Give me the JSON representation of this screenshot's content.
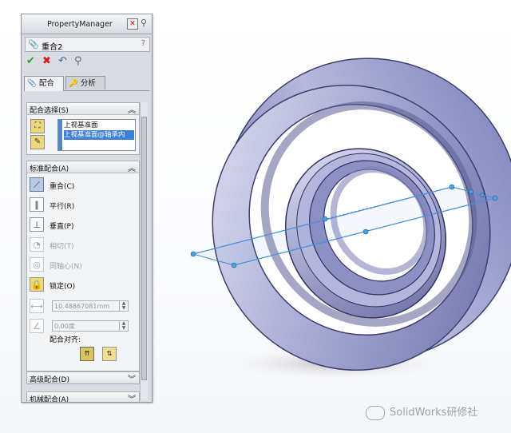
{
  "panel": {
    "title": "PropertyManager",
    "feature_name": "重合2",
    "help": "?",
    "tabs": [
      {
        "label": "配合"
      },
      {
        "label": "分析"
      }
    ],
    "sections": {
      "selections": {
        "title": "配合选择(S)",
        "items": [
          "上视基准面",
          "上视基准面@轴承内"
        ]
      },
      "standard": {
        "title": "标准配合(A)",
        "mates": [
          {
            "label": "重合(C)",
            "icon": "coincident-icon",
            "active": true,
            "enabled": true
          },
          {
            "label": "平行(R)",
            "icon": "parallel-icon",
            "active": false,
            "enabled": true
          },
          {
            "label": "垂直(P)",
            "icon": "perpendicular-icon",
            "active": false,
            "enabled": true
          },
          {
            "label": "相切(T)",
            "icon": "tangent-icon",
            "active": false,
            "enabled": false
          },
          {
            "label": "同轴心(N)",
            "icon": "concentric-icon",
            "active": false,
            "enabled": false
          },
          {
            "label": "锁定(O)",
            "icon": "lock-icon",
            "active": false,
            "enabled": true
          }
        ],
        "distance": "10.48867081mm",
        "angle": "0.00度",
        "alignment_label": "配合对齐:"
      },
      "advanced": {
        "title": "高级配合(D)"
      },
      "mechanical": {
        "title": "机械配合(A)"
      }
    }
  },
  "watermark": "SolidWorks研修社",
  "colors": {
    "ring": "#8c8fc4",
    "plane": "#4a90d9"
  }
}
